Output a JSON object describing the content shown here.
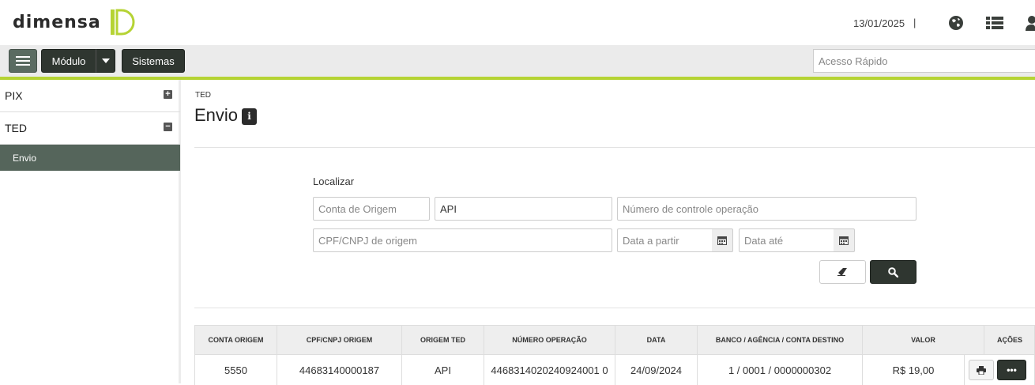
{
  "header": {
    "logo_text": "DIMENSA",
    "date": "13/01/2025",
    "separator": "|",
    "icons": [
      "globe-icon",
      "list-icon",
      "user-icon"
    ]
  },
  "toolbar": {
    "menu_icon": "hamburger-icon",
    "modulo_label": "Módulo",
    "sistemas_label": "Sistemas",
    "quick_access_placeholder": "Acesso Rápido"
  },
  "sidebar": {
    "items": [
      {
        "label": "PIX",
        "toggle": "+"
      },
      {
        "label": "TED",
        "toggle": "−"
      }
    ],
    "sub_items": [
      {
        "label": "Envio"
      }
    ]
  },
  "main": {
    "breadcrumb": "TED",
    "title": "Envio",
    "info_icon": "i",
    "search": {
      "label": "Localizar",
      "conta_origem_placeholder": "Conta de Origem",
      "origem_value": "API",
      "numero_controle_placeholder": "Número de controle operação",
      "cpf_cnpj_placeholder": "CPF/CNPJ de origem",
      "data_partir_placeholder": "Data a partir",
      "data_ate_placeholder": "Data até"
    }
  },
  "table": {
    "headers": [
      "CONTA ORIGEM",
      "CPF/CNPJ ORIGEM",
      "ORIGEM TED",
      "NÚMERO OPERAÇÃO",
      "DATA",
      "BANCO / AGÊNCIA / CONTA DESTINO",
      "VALOR",
      "AÇÕES"
    ],
    "rows": [
      [
        "5550",
        "44683140000187",
        "API",
        "4468314020240924001 0",
        "24/09/2024",
        "1 / 0001 / 0000000302",
        "R$ 19,00"
      ]
    ],
    "more_label": "•••"
  },
  "colors": {
    "accent_green": "#b5d334",
    "dark_button": "#2f3630",
    "sidebar_active": "#55655b"
  }
}
